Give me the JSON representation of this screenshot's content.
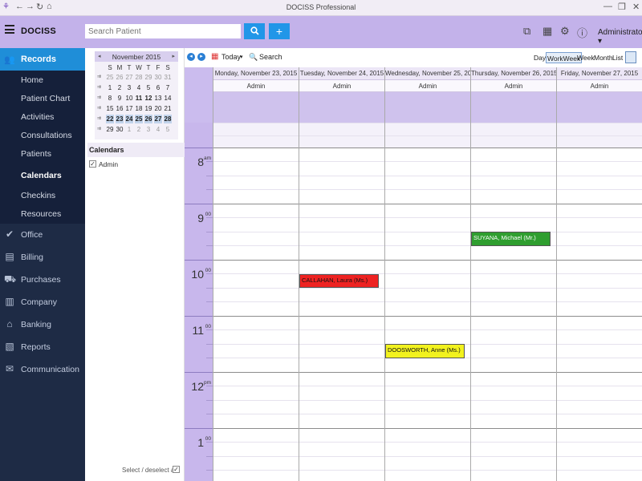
{
  "window": {
    "title": "DOCISS Professional",
    "controls": [
      "—",
      "❐",
      "✕"
    ]
  },
  "header": {
    "app_name": "DOCISS",
    "search_placeholder": "Search Patient",
    "user": "Administrator",
    "user_caret": "▾"
  },
  "sidebar": {
    "records": "Records",
    "sub_items": [
      {
        "label": "Home"
      },
      {
        "label": "Patient Chart"
      },
      {
        "label": "Activities"
      },
      {
        "label": "Consultations"
      },
      {
        "label": "Patients"
      },
      {
        "label": "Calendars"
      },
      {
        "label": "Checkins"
      },
      {
        "label": "Resources"
      }
    ],
    "active_sub_item": "Calendars",
    "items": [
      {
        "label": "Office",
        "icon": "check-circle-icon"
      },
      {
        "label": "Billing",
        "icon": "billing-icon"
      },
      {
        "label": "Purchases",
        "icon": "cart-icon"
      },
      {
        "label": "Company",
        "icon": "building-icon"
      },
      {
        "label": "Banking",
        "icon": "bank-icon"
      },
      {
        "label": "Reports",
        "icon": "reports-icon"
      },
      {
        "label": "Communication",
        "icon": "envelope-icon"
      }
    ]
  },
  "mini_calendar": {
    "month": "November 2015",
    "prev": "◂",
    "next": "▸",
    "weekday_headers": [
      "S",
      "M",
      "T",
      "W",
      "T",
      "F",
      "S"
    ],
    "weeks": [
      [
        "25",
        "26",
        "27",
        "28",
        "29",
        "30",
        "31"
      ],
      [
        "1",
        "2",
        "3",
        "4",
        "5",
        "6",
        "7"
      ],
      [
        "8",
        "9",
        "10",
        "11",
        "12",
        "13",
        "14"
      ],
      [
        "15",
        "16",
        "17",
        "18",
        "19",
        "20",
        "21"
      ],
      [
        "22",
        "23",
        "24",
        "25",
        "26",
        "27",
        "28"
      ],
      [
        "29",
        "30",
        "1",
        "2",
        "3",
        "4",
        "5"
      ]
    ],
    "selected_week": 4,
    "week_marker": "⇉"
  },
  "calendars_panel": {
    "title": "Calendars",
    "items": [
      {
        "label": "Admin",
        "checked": true
      }
    ],
    "select_all": "Select / deselect all"
  },
  "toolbar": {
    "today": "Today",
    "today_caret": "▾",
    "search": "Search",
    "views": [
      "Day",
      "WorkWeek",
      "Week",
      "Month",
      "List"
    ],
    "active_view": "WorkWeek"
  },
  "calendar": {
    "days": [
      {
        "header": "Monday, November 23, 2015",
        "resource": "Admin"
      },
      {
        "header": "Tuesday, November 24, 2015",
        "resource": "Admin"
      },
      {
        "header": "Wednesday, November 25, 2015",
        "resource": "Admin"
      },
      {
        "header": "Thursday, November 26, 2015",
        "resource": "Admin"
      },
      {
        "header": "Friday, November 27, 2015",
        "resource": "Admin"
      }
    ],
    "hours": [
      {
        "h": "8",
        "s": "am"
      },
      {
        "h": "9",
        "s": "00"
      },
      {
        "h": "10",
        "s": "00"
      },
      {
        "h": "11",
        "s": "00"
      },
      {
        "h": "12",
        "s": "pm"
      },
      {
        "h": "1",
        "s": "00"
      }
    ],
    "appointments": [
      {
        "day": 1,
        "start": "10:15",
        "end": "10:30",
        "label": "CALLAHAN, Laura (Ms.)",
        "color": "#ee2222"
      },
      {
        "day": 3,
        "start": "9:30",
        "end": "9:45",
        "label": "SUYANA, Michael (Mr.)",
        "color": "#2f9e2f"
      },
      {
        "day": 2,
        "start": "11:30",
        "end": "11:45",
        "label": "DOOSWORTH, Anne (Ms.)",
        "color": "#f2f21e"
      }
    ]
  },
  "colors": {
    "header_bg": "#c3b2ea",
    "sidebar_bg": "#1e2b45",
    "accent_blue": "#1f8ed8"
  }
}
